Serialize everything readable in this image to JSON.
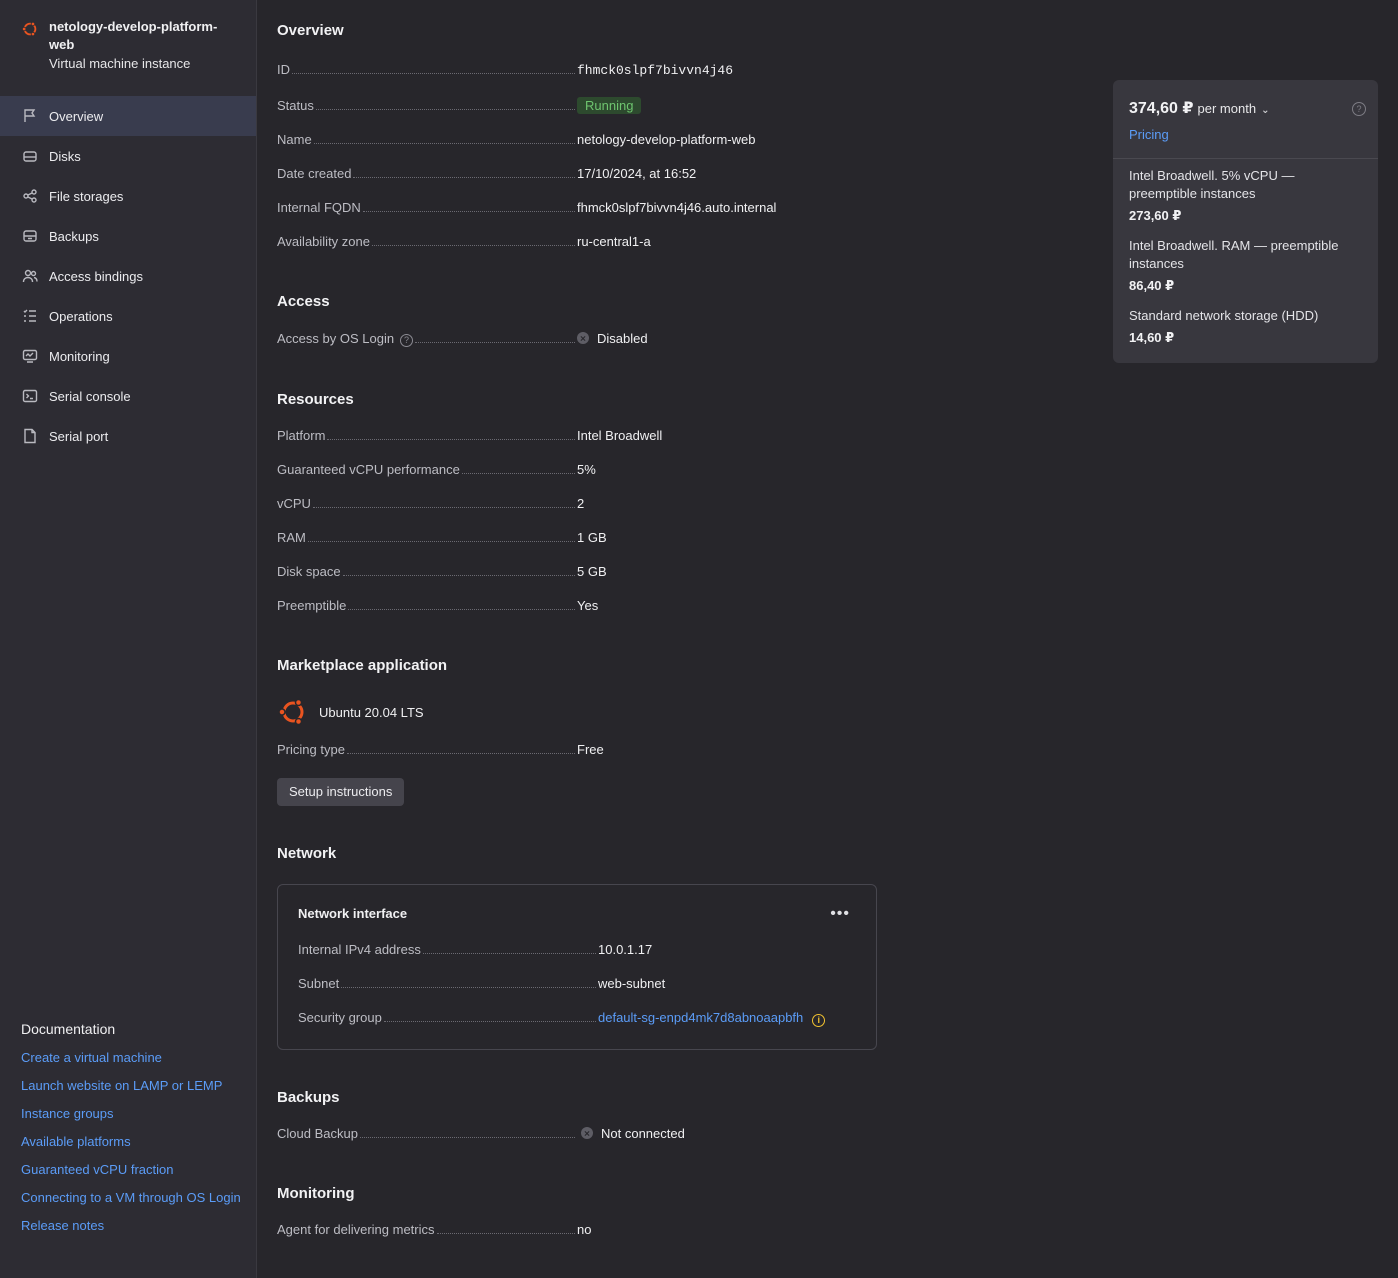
{
  "sidebar": {
    "title": "netology-develop-platform-web",
    "subtitle": "Virtual machine instance",
    "items": [
      {
        "label": "Overview",
        "icon": "flag-icon"
      },
      {
        "label": "Disks",
        "icon": "disk-icon"
      },
      {
        "label": "File storages",
        "icon": "share-icon"
      },
      {
        "label": "Backups",
        "icon": "backup-icon"
      },
      {
        "label": "Access bindings",
        "icon": "users-icon"
      },
      {
        "label": "Operations",
        "icon": "list-icon"
      },
      {
        "label": "Monitoring",
        "icon": "monitor-icon"
      },
      {
        "label": "Serial console",
        "icon": "terminal-icon"
      },
      {
        "label": "Serial port",
        "icon": "file-icon"
      }
    ],
    "docs": {
      "title": "Documentation",
      "links": [
        "Create a virtual machine",
        "Launch website on LAMP or LEMP",
        "Instance groups",
        "Available platforms",
        "Guaranteed vCPU fraction",
        "Connecting to a VM through OS Login",
        "Release notes"
      ]
    }
  },
  "overview": {
    "title": "Overview",
    "id_label": "ID",
    "id": "fhmck0slpf7bivvn4j46",
    "status_label": "Status",
    "status": "Running",
    "name_label": "Name",
    "name": "netology-develop-platform-web",
    "date_label": "Date created",
    "date": "17/10/2024, at 16:52",
    "fqdn_label": "Internal FQDN",
    "fqdn": "fhmck0slpf7bivvn4j46.auto.internal",
    "zone_label": "Availability zone",
    "zone": "ru-central1-a"
  },
  "access": {
    "title": "Access",
    "os_login_label": "Access by OS Login",
    "os_login": "Disabled"
  },
  "resources": {
    "title": "Resources",
    "platform_label": "Platform",
    "platform": "Intel Broadwell",
    "vcpu_perf_label": "Guaranteed vCPU performance",
    "vcpu_perf": "5%",
    "vcpu_label": "vCPU",
    "vcpu": "2",
    "ram_label": "RAM",
    "ram": "1 GB",
    "disk_label": "Disk space",
    "disk": "5 GB",
    "preemptible_label": "Preemptible",
    "preemptible": "Yes"
  },
  "marketplace": {
    "title": "Marketplace application",
    "app_name": "Ubuntu 20.04 LTS",
    "pricing_type_label": "Pricing type",
    "pricing_type": "Free",
    "setup_button": "Setup instructions"
  },
  "network": {
    "title": "Network",
    "card_title": "Network interface",
    "more": "•••",
    "ipv4_label": "Internal IPv4 address",
    "ipv4": "10.0.1.17",
    "subnet_label": "Subnet",
    "subnet": "web-subnet",
    "sg_label": "Security group",
    "sg": "default-sg-enpd4mk7d8abnoaapbfh"
  },
  "backups": {
    "title": "Backups",
    "cloud_label": "Cloud Backup",
    "cloud": "Not connected"
  },
  "monitoring": {
    "title": "Monitoring",
    "agent_label": "Agent for delivering metrics",
    "agent": "no"
  },
  "pricing": {
    "total": "374,60 ₽",
    "period": "per month",
    "link": "Pricing",
    "items": [
      {
        "name": "Intel Broadwell. 5% vCPU — preemptible instances",
        "value": "273,60 ₽"
      },
      {
        "name": "Intel Broadwell. RAM — preemptible instances",
        "value": "86,40 ₽"
      },
      {
        "name": "Standard network storage (HDD)",
        "value": "14,60 ₽"
      }
    ]
  },
  "colors": {
    "background": "#27262b",
    "sidebar": "#2d2c33",
    "active_nav": "#393c4e",
    "link": "#5b9cf7",
    "running": "#6ec56f",
    "brand_ubuntu": "#e95420",
    "warning": "#f2c230"
  }
}
